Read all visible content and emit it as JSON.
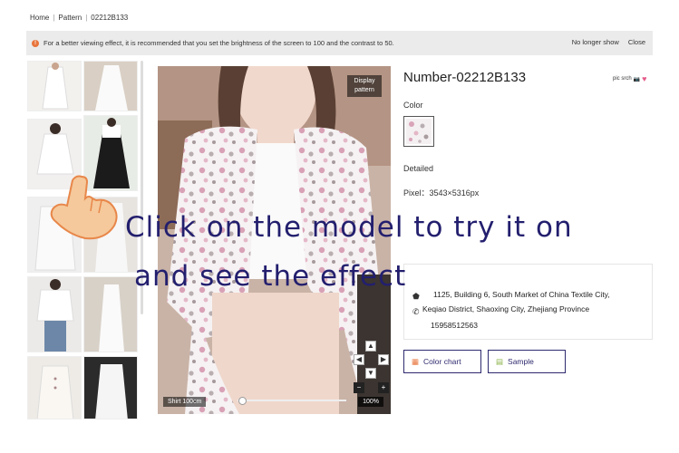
{
  "breadcrumb": {
    "home": "Home",
    "sep": "|",
    "pattern": "Pattern",
    "id": "02212B133"
  },
  "notice": {
    "text": "For a better viewing effect, it is recommended that you set the brightness of the screen to 100 and the contrast to 50.",
    "no_longer_show": "No longer show",
    "close": "Close"
  },
  "preview": {
    "display_pattern": "Display pattern",
    "size_label": "Shirt 100cm",
    "zoom": "100%"
  },
  "product": {
    "title": "Number-02212B133",
    "pic_search": "pic srch",
    "color_label": "Color",
    "detailed_label": "Detailed",
    "pixel": "Pixel：3543×5316px",
    "address_line1": "1125, Building 6, South Market of China Textile City,",
    "address_line2": "Keqiao District, Shaoxing City, Zhejiang Province",
    "phone": "15958512563"
  },
  "buttons": {
    "color_chart": "Color chart",
    "sample": "Sample"
  },
  "overlay": {
    "line1": "Click on the model to try it on",
    "line2": "and see the effect"
  },
  "icons": {
    "warning": "warning-icon",
    "camera": "camera-icon",
    "heart": "heart-icon",
    "location": "location-icon",
    "phone": "phone-icon",
    "hand": "pointing-hand-icon"
  },
  "colors": {
    "accent": "#2e2a6e",
    "warn": "#e8743b",
    "heart": "#e55b8b",
    "overlay_text": "#231f6e"
  }
}
